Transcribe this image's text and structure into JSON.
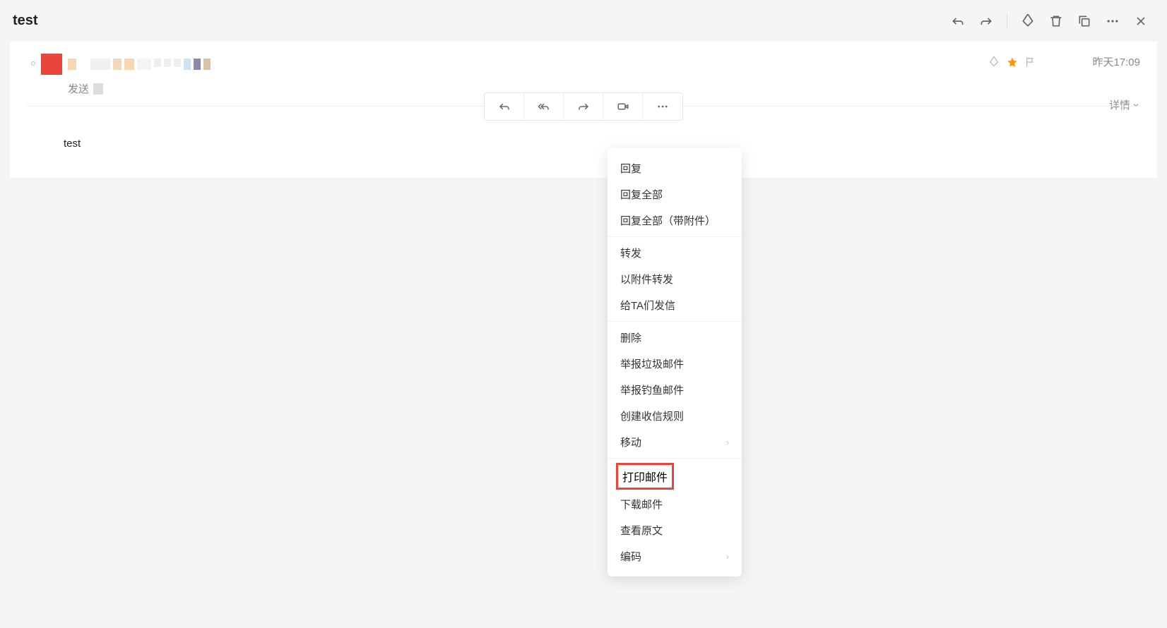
{
  "header": {
    "title": "test"
  },
  "email": {
    "sender_label": "发送",
    "timestamp": "昨天17:09",
    "details_label": "详情",
    "body_text": "test"
  },
  "menu": {
    "group1": [
      "回复",
      "回复全部",
      "回复全部（带附件）"
    ],
    "group2": [
      "转发",
      "以附件转发",
      "给TA们发信"
    ],
    "group3": [
      "删除",
      "举报垃圾邮件",
      "举报钓鱼邮件",
      "创建收信规则"
    ],
    "group3_sub": "移动",
    "group4_highlight": "打印邮件",
    "group4": [
      "下载邮件",
      "查看原文"
    ],
    "group4_sub": "编码"
  }
}
